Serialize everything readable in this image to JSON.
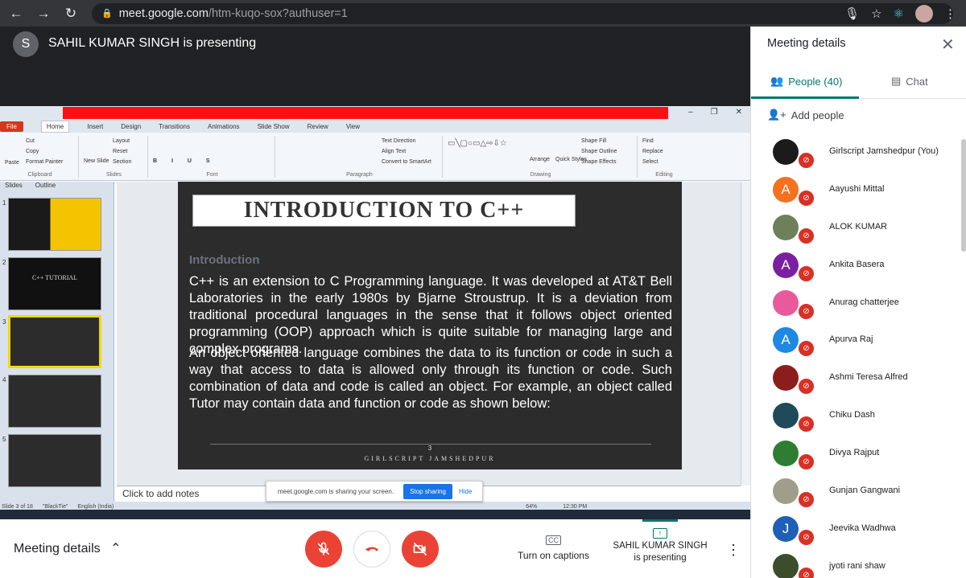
{
  "browser": {
    "url_host": "meet.google.com",
    "url_path": "/htm-kuqo-sox?authuser=1"
  },
  "presenter_bar": {
    "initial": "S",
    "text": "SAHIL KUMAR SINGH is presenting"
  },
  "ppt": {
    "tabs": [
      "File",
      "Home",
      "Insert",
      "Design",
      "Transitions",
      "Animations",
      "Slide Show",
      "Review",
      "View"
    ],
    "ribbon": {
      "paste": "Paste",
      "cut": "Cut",
      "copy": "Copy",
      "format_painter": "Format Painter",
      "clipboard": "Clipboard",
      "new_slide": "New Slide",
      "layout": "Layout",
      "reset": "Reset",
      "section": "Section",
      "slides": "Slides",
      "font": "Font",
      "text_direction": "Text Direction",
      "align_text": "Align Text",
      "convert_smartart": "Convert to SmartArt",
      "paragraph": "Paragraph",
      "arrange": "Arrange",
      "quick_styles": "Quick Styles",
      "shape_fill": "Shape Fill",
      "shape_outline": "Shape Outline",
      "shape_effects": "Shape Effects",
      "drawing": "Drawing",
      "find": "Find",
      "replace": "Replace",
      "select": "Select",
      "editing": "Editing"
    },
    "pane_tabs": [
      "Slides",
      "Outline"
    ],
    "thumbs": [
      "1",
      "2",
      "3",
      "4",
      "5"
    ],
    "thumb2_text": "C++ TUTORIAL",
    "slide": {
      "title": "INTRODUCTION TO C++",
      "subtitle": "Introduction",
      "para1": "C++ is an extension to C Programming language. It was developed at AT&T Bell Laboratories in the early 1980s by Bjarne Stroustrup. It is a deviation from traditional procedural languages in the sense that it follows object oriented programming (OOP) approach which is quite suitable for managing large and complex programs.",
      "para2": "An object oriented language combines the data to its function or code in such a way that access to data is allowed only through its function or code. Such combination of data and code is called an object. For example, an object called Tutor may contain data and function or code as shown below:",
      "page_number": "3",
      "footer": "GIRLSCRIPT JAMSHEDPUR"
    },
    "notes_placeholder": "Click to add notes",
    "status": {
      "slide_of": "Slide 3 of 18",
      "theme": "\"BlackTie\"",
      "language": "English (India)",
      "zoom": "64%",
      "clock": "12:30 PM"
    }
  },
  "share_notice": {
    "text": "meet.google.com is sharing your screen.",
    "stop": "Stop sharing",
    "hide": "Hide"
  },
  "bottom": {
    "meeting_details": "Meeting details",
    "captions_label": "Turn on captions",
    "captions_icon": "CC",
    "presenting_name": "SAHIL KUMAR SINGH",
    "presenting_sub": "is presenting"
  },
  "panel": {
    "title": "Meeting details",
    "people_tab": "People (40)",
    "chat_tab": "Chat",
    "add_people": "Add people",
    "participants": [
      {
        "name": "Girlscript Jamshedpur (You)",
        "initial": "",
        "color": "#1b1b1b"
      },
      {
        "name": "Aayushi Mittal",
        "initial": "A",
        "color": "#f4711f"
      },
      {
        "name": "ALOK KUMAR",
        "initial": "",
        "color": "#6f7f5a"
      },
      {
        "name": "Ankita Basera",
        "initial": "A",
        "color": "#7b1fa2"
      },
      {
        "name": "Anurag chatterjee",
        "initial": "",
        "color": "#e85a9b"
      },
      {
        "name": "Apurva Raj",
        "initial": "A",
        "color": "#1e88e5"
      },
      {
        "name": "Ashmi Teresa Alfred",
        "initial": "",
        "color": "#8c1d1d"
      },
      {
        "name": "Chiku Dash",
        "initial": "",
        "color": "#1f4a5a"
      },
      {
        "name": "Divya Rajput",
        "initial": "",
        "color": "#2e7d32"
      },
      {
        "name": "Gunjan Gangwani",
        "initial": "",
        "color": "#9e9e8a"
      },
      {
        "name": "Jeevika Wadhwa",
        "initial": "J",
        "color": "#1e5fb8"
      },
      {
        "name": "jyoti rani shaw",
        "initial": "",
        "color": "#3b4d2b"
      }
    ]
  }
}
